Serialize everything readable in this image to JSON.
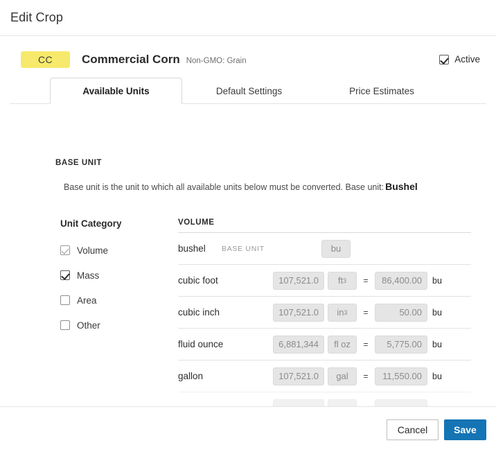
{
  "window": {
    "title": "Edit Crop"
  },
  "crop": {
    "badge": "CC",
    "name": "Commercial Corn",
    "subtitle": "Non-GMO: Grain",
    "active_label": "Active",
    "active_checked": true
  },
  "tabs": [
    {
      "label": "Available Units",
      "active": true
    },
    {
      "label": "Default Settings",
      "active": false
    },
    {
      "label": "Price Estimates",
      "active": false
    }
  ],
  "base_unit": {
    "heading": "BASE UNIT",
    "description": "Base unit is the unit to which all available units below must be converted. Base unit:",
    "value": "Bushel"
  },
  "unit_category": {
    "title": "Unit Category",
    "items": [
      {
        "label": "Volume",
        "checked": true,
        "muted": true
      },
      {
        "label": "Mass",
        "checked": true,
        "muted": false
      },
      {
        "label": "Area",
        "checked": false,
        "muted": false
      },
      {
        "label": "Other",
        "checked": false,
        "muted": false
      }
    ]
  },
  "volume_section": {
    "heading": "VOLUME",
    "base_unit_tag": "BASE UNIT",
    "equals": "=",
    "suffix": "bu",
    "rows": [
      {
        "name": "bushel",
        "is_base": true,
        "symbol": "bu",
        "symbol_sup": "",
        "value": "",
        "result": ""
      },
      {
        "name": "cubic foot",
        "is_base": false,
        "symbol": "ft",
        "symbol_sup": "3",
        "value": "107,521.0",
        "result": "86,400.00"
      },
      {
        "name": "cubic inch",
        "is_base": false,
        "symbol": "in",
        "symbol_sup": "3",
        "value": "107,521.0",
        "result": "50.00"
      },
      {
        "name": "fluid ounce",
        "is_base": false,
        "symbol": "fl oz",
        "symbol_sup": "",
        "value": "6,881,344",
        "result": "5,775.00"
      },
      {
        "name": "gallon",
        "is_base": false,
        "symbol": "gal",
        "symbol_sup": "",
        "value": "107,521.0",
        "result": "11,550.00"
      }
    ]
  },
  "footer": {
    "cancel_label": "Cancel",
    "save_label": "Save"
  },
  "colors": {
    "badge_yellow": "#F7E96B",
    "save_blue": "#1474B4",
    "field_grey": "#E5E5E5"
  }
}
